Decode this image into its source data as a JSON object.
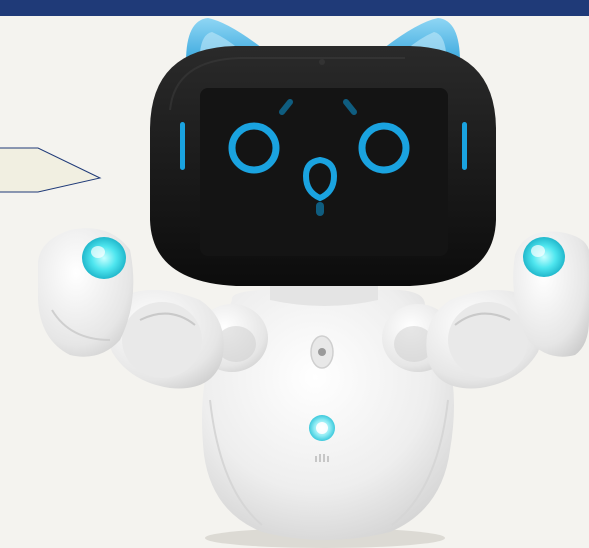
{
  "page": {
    "banner_color": "#1f3a78",
    "background_color": "#f4f3ef"
  },
  "speech_bubble": {
    "text": "",
    "fill": "#f1efe1",
    "outline": "#1f3a78"
  },
  "robot": {
    "icon": "robot-icon",
    "body_color": "#f3f3f3",
    "ear_color": "#6cc4ec",
    "screen_color": "#121212",
    "face_glow_color": "#1aa3e0",
    "hand_glow_color": "#4fe6ef",
    "chest_button_color": "#6fe3f0"
  }
}
